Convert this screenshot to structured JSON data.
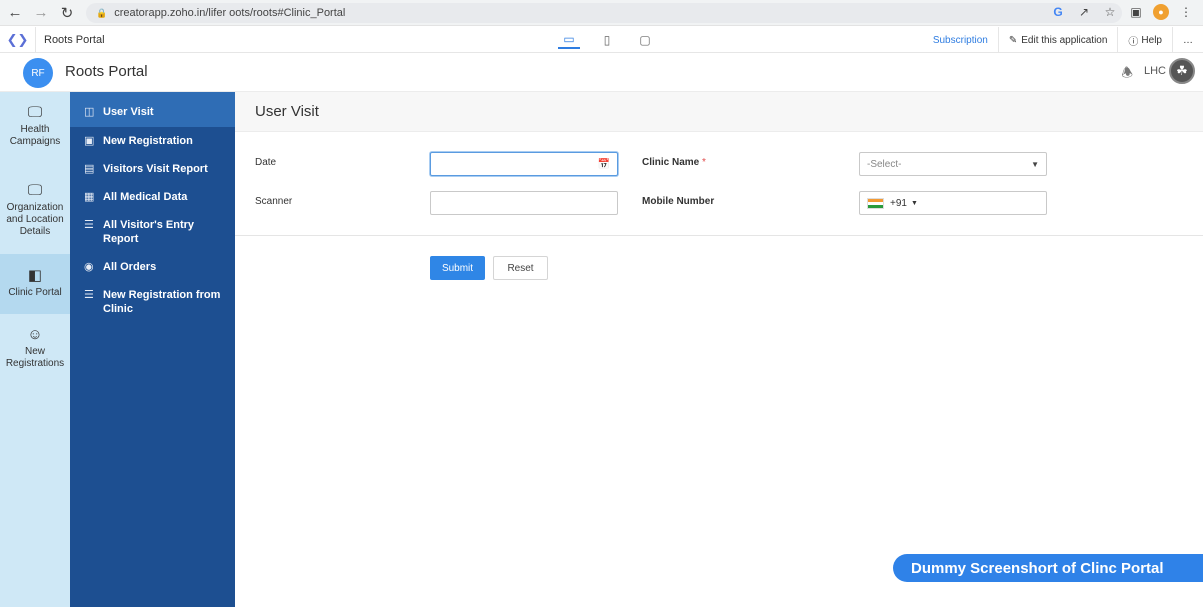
{
  "browser": {
    "url": "creatorapp.zoho.in/lifer oots/roots#Clinic_Portal"
  },
  "appbar": {
    "app_name": "Roots Portal",
    "subscription": "Subscription",
    "edit": "Edit this application",
    "help": "Help",
    "more": "…"
  },
  "portal": {
    "badge": "RF",
    "title": "Roots Portal",
    "user": "LHC"
  },
  "leftnav": [
    {
      "icon": "campaign-icon",
      "label": "Health Campaigns"
    },
    {
      "icon": "location-icon",
      "label": "Organization and Location Details"
    },
    {
      "icon": "clinic-icon",
      "label": "Clinic Portal"
    },
    {
      "icon": "registration-icon",
      "label": "New Registrations"
    }
  ],
  "subnav": [
    {
      "icon": "doc-icon",
      "label": "User Visit"
    },
    {
      "icon": "registration-icon",
      "label": "New Registration"
    },
    {
      "icon": "report-icon",
      "label": "Visitors Visit Report"
    },
    {
      "icon": "medical-icon",
      "label": "All Medical Data"
    },
    {
      "icon": "list-icon",
      "label": "All Visitor's Entry Report"
    },
    {
      "icon": "globe-icon",
      "label": "All Orders"
    },
    {
      "icon": "list-icon",
      "label": "New Registration from Clinic"
    }
  ],
  "page": {
    "title": "User Visit",
    "fields": {
      "date_label": "Date",
      "clinic_label": "Clinic Name",
      "clinic_required": "*",
      "clinic_placeholder": "-Select-",
      "scanner_label": "Scanner",
      "mobile_label": "Mobile Number",
      "country_code": "+91"
    },
    "submit": "Submit",
    "reset": "Reset"
  },
  "banner": "Dummy Screenshort of Clinc Portal",
  "colors": {
    "leftnav_bg": "#cfe8f6",
    "subnav_bg": "#1d4f91",
    "accent": "#2f86e6"
  }
}
